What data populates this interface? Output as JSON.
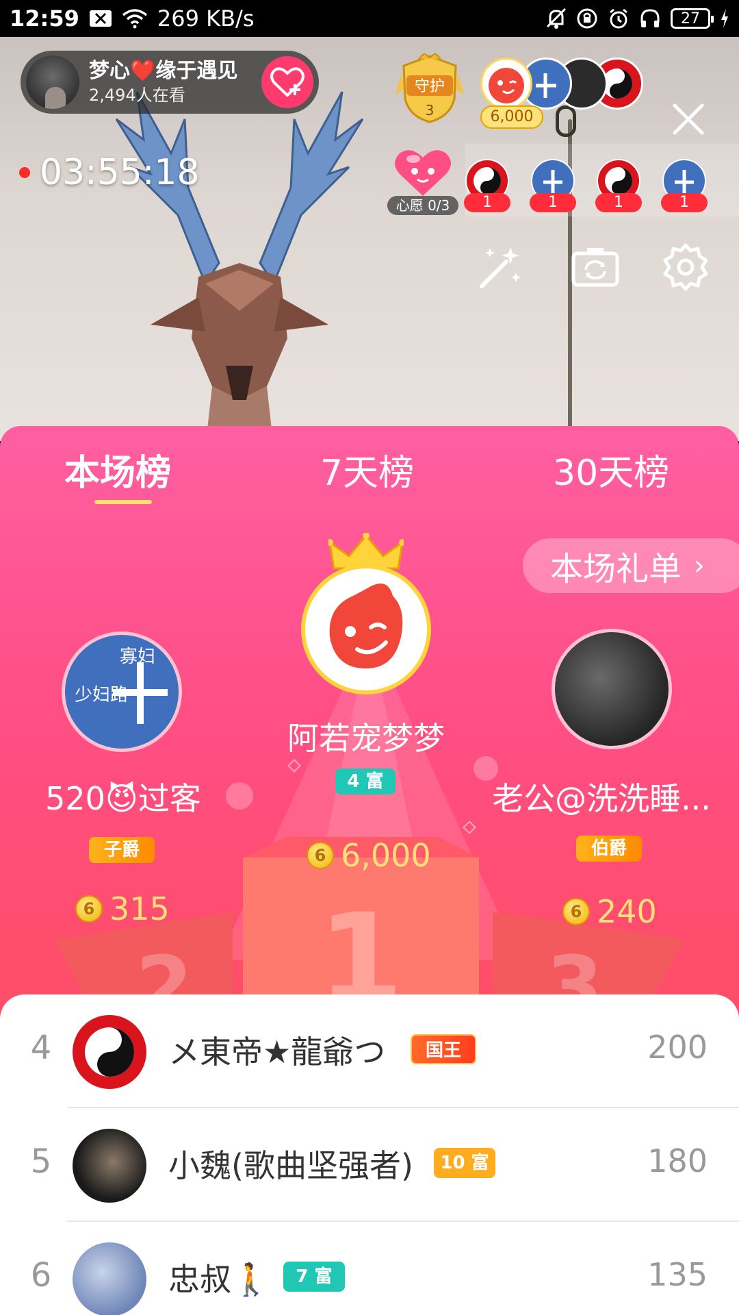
{
  "status_bar": {
    "time": "12:59",
    "network_speed": "269 KB/s",
    "battery": "27"
  },
  "live": {
    "host_name": "梦心❤️缘于遇见",
    "viewers": "2,494人在看",
    "guard_label": "守护",
    "guard_count": "3",
    "top_gift_score": "6,000",
    "timer": "03:55:18",
    "wish_label": "心愿 0/3",
    "fans": [
      {
        "count": "1"
      },
      {
        "count": "1"
      },
      {
        "count": "1"
      },
      {
        "count": "1"
      }
    ]
  },
  "board": {
    "tabs": [
      "本场榜",
      "7天榜",
      "30天榜"
    ],
    "active_tab": 0,
    "gift_list_button": "本场礼单",
    "top3": [
      {
        "rank": "1",
        "name": "阿若宠梦梦",
        "level": "4 富",
        "score": "6,000"
      },
      {
        "rank": "2",
        "name": "520😈过客",
        "level": "子爵",
        "score": "315"
      },
      {
        "rank": "3",
        "name": "老公@洗洗睡...",
        "level": "伯爵",
        "score": "240"
      }
    ],
    "list": [
      {
        "rank": "4",
        "name": "メ東帝★龍爺つ",
        "badge": "国王",
        "score": "200"
      },
      {
        "rank": "5",
        "name": "小魏(歌曲坚强者)",
        "badge": "10 富",
        "score": "180"
      },
      {
        "rank": "6",
        "name": "忠叔🚶",
        "badge": "7 富",
        "score": "135"
      }
    ]
  },
  "colors": {
    "board_top": "#ff5fa2",
    "board_bottom": "#ff5a5a",
    "score_gold": "#ffe07a",
    "follow_pink": "#ff3b6d",
    "rec_red": "#ff2a2a"
  }
}
